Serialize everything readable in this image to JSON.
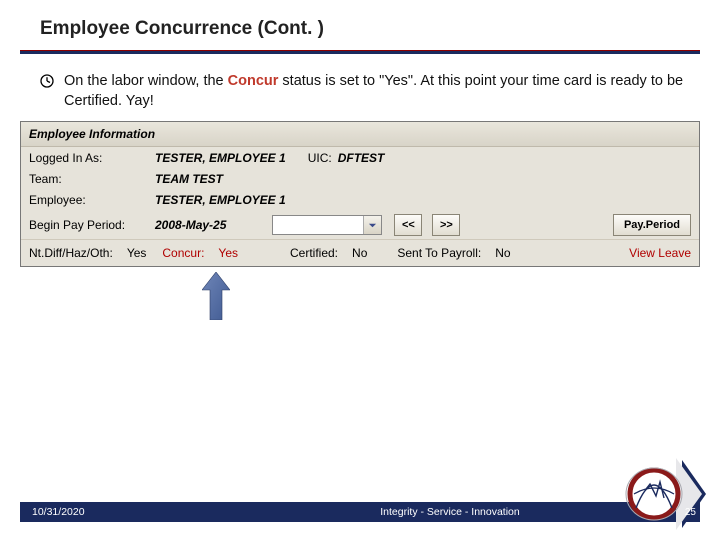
{
  "title": "Employee Concurrence (Cont. )",
  "bullet": {
    "pre": "On the labor window, the ",
    "hl": "Concur",
    "post": " status is set to \"Yes\".  At this point your time card is ready to be Certified. Yay!"
  },
  "panel": {
    "header": "Employee Information",
    "row1": {
      "label": "Logged In As:",
      "value": "TESTER, EMPLOYEE 1",
      "uic_label": "UIC:",
      "uic_value": "DFTEST"
    },
    "row2": {
      "label": "Team:",
      "value": "TEAM TEST"
    },
    "row3": {
      "label": "Employee:",
      "value": "TESTER, EMPLOYEE 1"
    },
    "row4": {
      "label": "Begin Pay Period:",
      "value": "2008-May-25",
      "prev": "<<",
      "next": ">>",
      "pp_button": "Pay.Period"
    },
    "row5": {
      "ndh_label": "Nt.Diff/Haz/Oth:",
      "ndh_value": "Yes",
      "concur_label": "Concur:",
      "concur_value": "Yes",
      "cert_label": "Certified:",
      "cert_value": "No",
      "payroll_label": "Sent To Payroll:",
      "payroll_value": "No",
      "view_leave": "View Leave"
    }
  },
  "footer": {
    "date": "10/31/2020",
    "tagline": "Integrity - Service - Innovation",
    "page": "25"
  }
}
